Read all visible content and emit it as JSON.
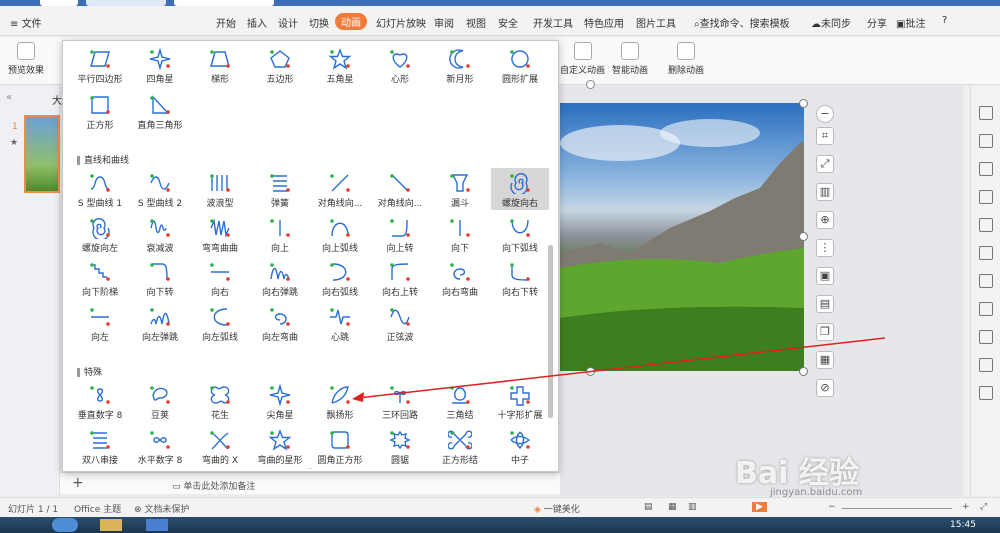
{
  "menubar": {
    "file": "文件",
    "items": [
      "开始",
      "插入",
      "设计",
      "切换",
      "动画",
      "幻灯片放映",
      "审阅",
      "视图",
      "安全",
      "开发工具",
      "特色应用",
      "图片工具"
    ],
    "active": "动画",
    "search": "查找命令、搜索模板",
    "sync": "未同步",
    "share": "分享",
    "comment": "批注",
    "help": "?"
  },
  "ribbon": {
    "preview": "预览效果",
    "custom_anim": "自定义动画",
    "smart_anim": "智能动画",
    "delete_anim": "删除动画"
  },
  "left_panel": {
    "tab": "大",
    "slide_num": "1",
    "star": "★"
  },
  "dropdown": {
    "row0": [
      {
        "label": "平行四边形",
        "icon": "parallelogram"
      },
      {
        "label": "四角星",
        "icon": "star4"
      },
      {
        "label": "梯形",
        "icon": "trapezoid"
      },
      {
        "label": "五边形",
        "icon": "pentagon"
      },
      {
        "label": "五角星",
        "icon": "star5"
      },
      {
        "label": "心形",
        "icon": "heart"
      },
      {
        "label": "新月形",
        "icon": "moon"
      },
      {
        "label": "圆形扩展",
        "icon": "circle"
      }
    ],
    "row1": [
      {
        "label": "正方形",
        "icon": "square"
      },
      {
        "label": "直角三角形",
        "icon": "triangle"
      }
    ],
    "section_lines": "直线和曲线",
    "lines": [
      {
        "label": "S 型曲线 1",
        "icon": "s1"
      },
      {
        "label": "S 型曲线 2",
        "icon": "s2"
      },
      {
        "label": "波浪型",
        "icon": "wave"
      },
      {
        "label": "弹簧",
        "icon": "spring"
      },
      {
        "label": "对角线向...",
        "icon": "diag1"
      },
      {
        "label": "对角线向...",
        "icon": "diag2"
      },
      {
        "label": "漏斗",
        "icon": "funnel"
      },
      {
        "label": "螺旋向右",
        "icon": "spiralR",
        "selected": true
      },
      {
        "label": "螺旋向左",
        "icon": "spiralL"
      },
      {
        "label": "衰减波",
        "icon": "decay"
      },
      {
        "label": "弯弯曲曲",
        "icon": "zigzag"
      },
      {
        "label": "向上",
        "icon": "up"
      },
      {
        "label": "向上弧线",
        "icon": "arcup"
      },
      {
        "label": "向上转",
        "icon": "turnup"
      },
      {
        "label": "向下",
        "icon": "down"
      },
      {
        "label": "向下弧线",
        "icon": "arcdown"
      },
      {
        "label": "向下阶梯",
        "icon": "stairs"
      },
      {
        "label": "向下转",
        "icon": "turndown"
      },
      {
        "label": "向右",
        "icon": "right"
      },
      {
        "label": "向右弹跳",
        "icon": "bounceR"
      },
      {
        "label": "向右弧线",
        "icon": "arcright"
      },
      {
        "label": "向右上转",
        "icon": "turnrightup"
      },
      {
        "label": "向右弯曲",
        "icon": "curveright"
      },
      {
        "label": "向右下转",
        "icon": "turnrightdown"
      },
      {
        "label": "向左",
        "icon": "left"
      },
      {
        "label": "向左弹跳",
        "icon": "bounceL"
      },
      {
        "label": "向左弧线",
        "icon": "arcleft"
      },
      {
        "label": "向左弯曲",
        "icon": "curveleft"
      },
      {
        "label": "心跳",
        "icon": "heartbeat"
      },
      {
        "label": "正弦波",
        "icon": "sine"
      }
    ],
    "section_special": "特殊",
    "special": [
      {
        "label": "垂直数字 8",
        "icon": "eight"
      },
      {
        "label": "豆荚",
        "icon": "bean"
      },
      {
        "label": "花生",
        "icon": "peanut"
      },
      {
        "label": "尖角星",
        "icon": "star4"
      },
      {
        "label": "飘扬形",
        "icon": "leaf"
      },
      {
        "label": "三环回路",
        "icon": "loop3"
      },
      {
        "label": "三角结",
        "icon": "knot"
      },
      {
        "label": "十字形扩展",
        "icon": "cross"
      },
      {
        "label": "双八串接",
        "icon": "spring"
      },
      {
        "label": "水平数字 8",
        "icon": "eighth"
      },
      {
        "label": "弯曲的 X",
        "icon": "cx"
      },
      {
        "label": "弯曲的星形",
        "icon": "star5"
      },
      {
        "label": "圆角正方形",
        "icon": "rsquare"
      },
      {
        "label": "圆锯",
        "icon": "saw"
      },
      {
        "label": "正方形结",
        "icon": "sqknot"
      },
      {
        "label": "中子",
        "icon": "neutron"
      }
    ]
  },
  "notes": {
    "placeholder": "单击此处添加备注"
  },
  "status": {
    "slide": "幻灯片 1 / 1",
    "theme": "Office 主题",
    "protect": "文档未保护",
    "beautify": "一键美化",
    "zoom_minus": "−",
    "zoom_plus": "+"
  },
  "taskbar": {
    "time": "15:45"
  },
  "watermark": {
    "text": "Bai 经验",
    "url": "jingyan.baidu.com"
  },
  "colors": {
    "accent": "#f07c3c",
    "path_green": "#2bb34a",
    "path_red": "#e23b2b",
    "path_blue": "#2a6fd6",
    "arrow": "#e02020"
  }
}
